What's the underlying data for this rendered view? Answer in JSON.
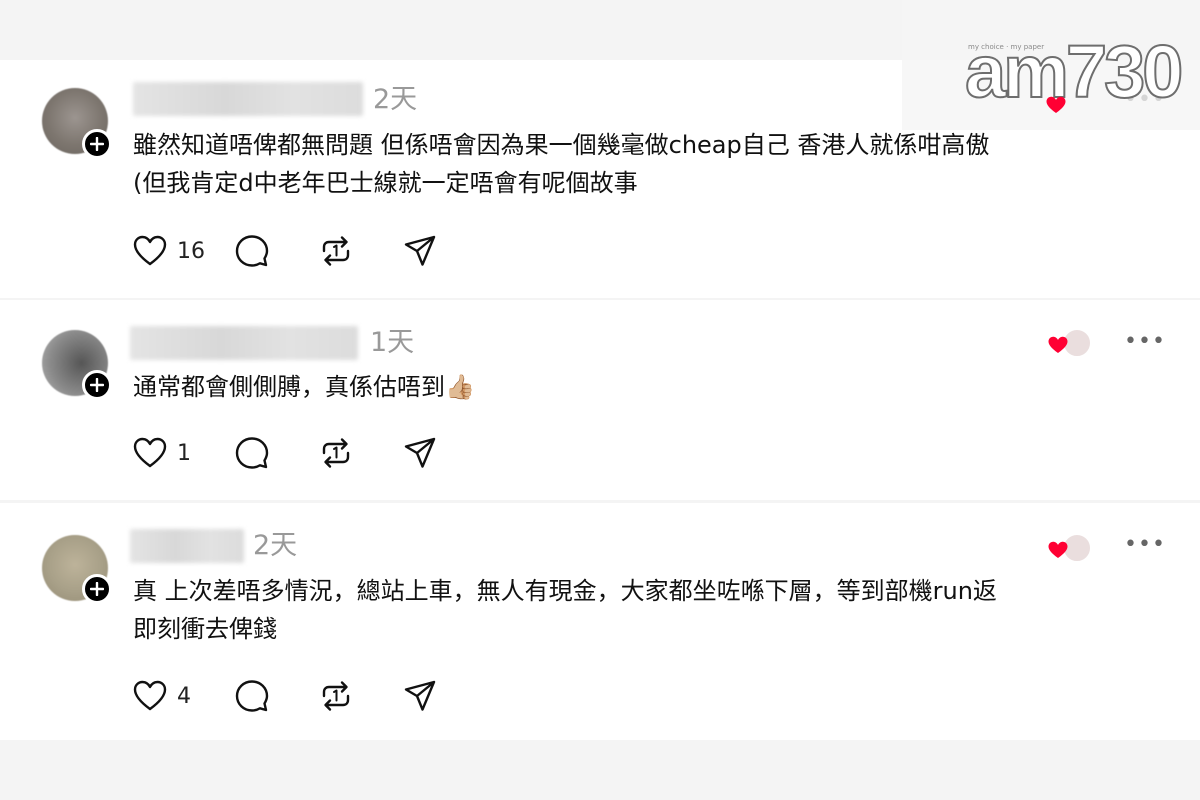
{
  "brand": {
    "logo_text": "am730",
    "tagline": "my choice · my paper"
  },
  "posts": [
    {
      "username": "",
      "time": "2天",
      "text": "雖然知道唔俾都無問題 但係唔會因為果一個幾毫做cheap自己 香港人就係咁高傲\n(但我肯定d中老年巴士線就一定唔會有呢個故事",
      "likes": "16",
      "icons": [
        "like-icon",
        "reply-icon",
        "repost-icon",
        "share-icon"
      ]
    },
    {
      "username": "",
      "time": "1天",
      "text": "通常都會側側膊，真係估唔到👍🏼",
      "likes": "1",
      "icons": [
        "like-icon",
        "reply-icon",
        "repost-icon",
        "share-icon"
      ]
    },
    {
      "username": "",
      "time": "2天",
      "text": "真 上次差唔多情況，總站上車，無人有現金，大家都坐咗喺下層，等到部機run返\n即刻衝去俾錢",
      "likes": "4",
      "icons": [
        "like-icon",
        "reply-icon",
        "repost-icon",
        "share-icon"
      ]
    }
  ],
  "colors": {
    "heart_red": "#ff0033",
    "time_gray": "#999999",
    "divider_gray": "#f4f4f4"
  },
  "more_label": "•••"
}
